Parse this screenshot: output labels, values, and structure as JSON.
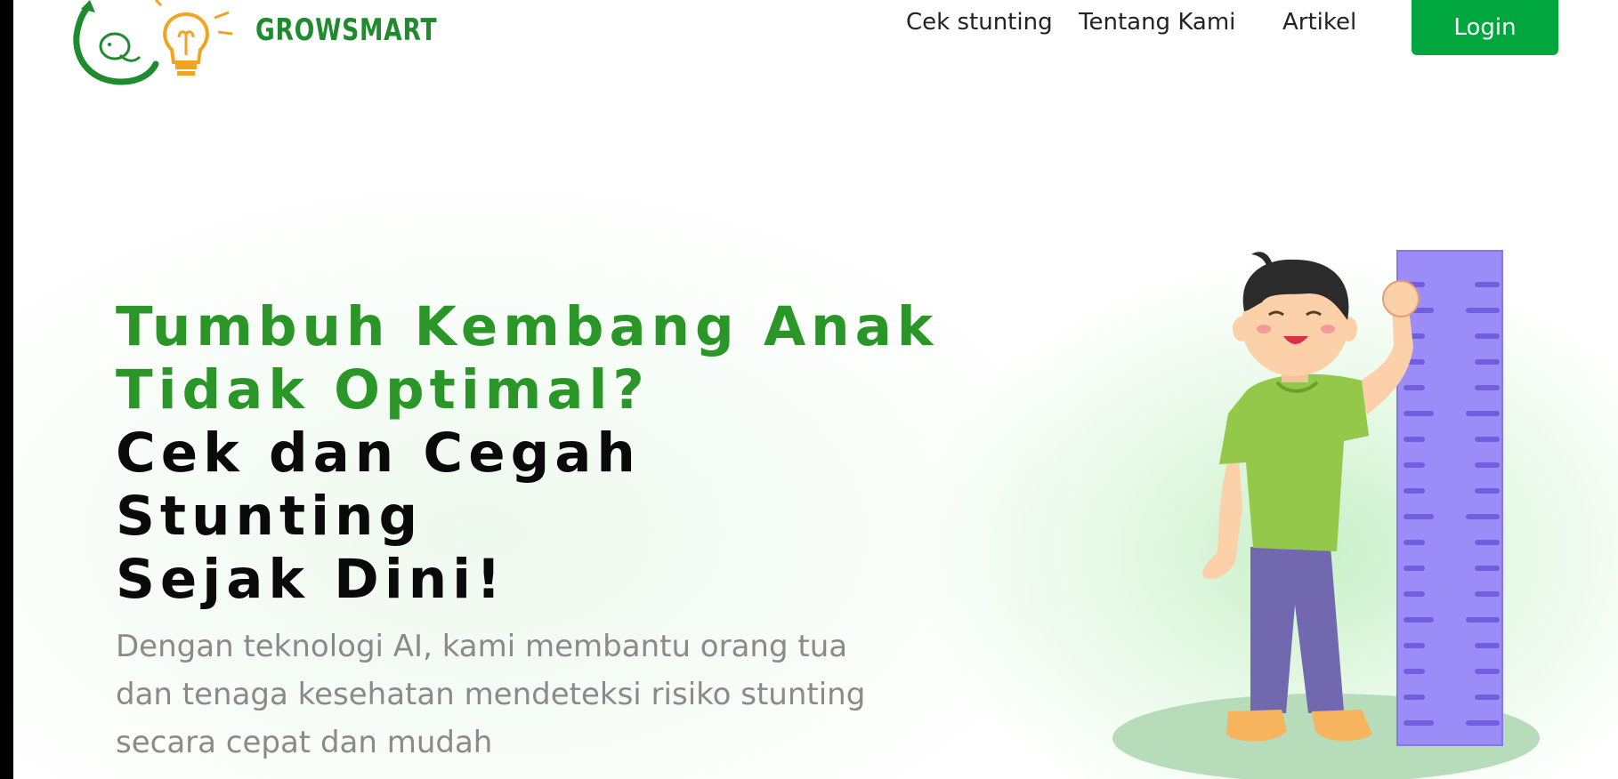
{
  "brand": {
    "name": "GROWSMART"
  },
  "nav": {
    "items": [
      {
        "label": "Cek stunting"
      },
      {
        "label": "Tentang Kami"
      },
      {
        "label": "Artikel"
      }
    ],
    "login_label": "Login"
  },
  "hero": {
    "headline_green_1": "Tumbuh Kembang Anak",
    "headline_green_2": "Tidak Optimal?",
    "headline_black_1": "Cek dan Cegah Stunting",
    "headline_black_2": "Sejak Dini!",
    "subtext_line_1": "Dengan teknologi AI, kami membantu orang tua",
    "subtext_line_2": "dan tenaga kesehatan mendeteksi risiko stunting",
    "subtext_line_3": "secara cepat dan mudah"
  },
  "colors": {
    "accent": "#00a63e",
    "headline_green": "#2a9628",
    "ruler": "#9b8cf7",
    "shirt": "#93c84a",
    "pants": "#7268b0"
  },
  "icons": {
    "logo": "growsmart-logo-icon",
    "illustration": "child-height-ruler-illustration"
  }
}
